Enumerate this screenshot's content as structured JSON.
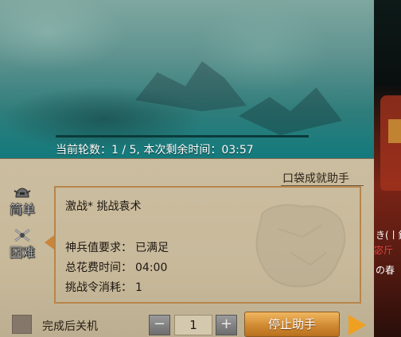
{
  "header": {
    "round_text": "当前轮数：1 / 5, 本次剩余时间：03:57",
    "progress_fraction": 0.0
  },
  "assistant": {
    "title": "口袋成就助手"
  },
  "modes": {
    "easy_label": "简单",
    "hard_label": "困难"
  },
  "stage": {
    "name": "激战* 挑战袁术",
    "requirement_label": "神兵值要求：",
    "requirement_value": "已满足",
    "time_label": "总花费时间：",
    "time_value": "04:00",
    "cost_label": "挑战令消耗：",
    "cost_value": "1"
  },
  "controls": {
    "shutdown_label": "完成后关机",
    "minus_symbol": "−",
    "plus_symbol": "+",
    "count_value": "1",
    "stop_label": "停止助手"
  },
  "side_text": {
    "line1": "き(丨鍟",
    "line2": "宓斤",
    "line3": "の春"
  }
}
